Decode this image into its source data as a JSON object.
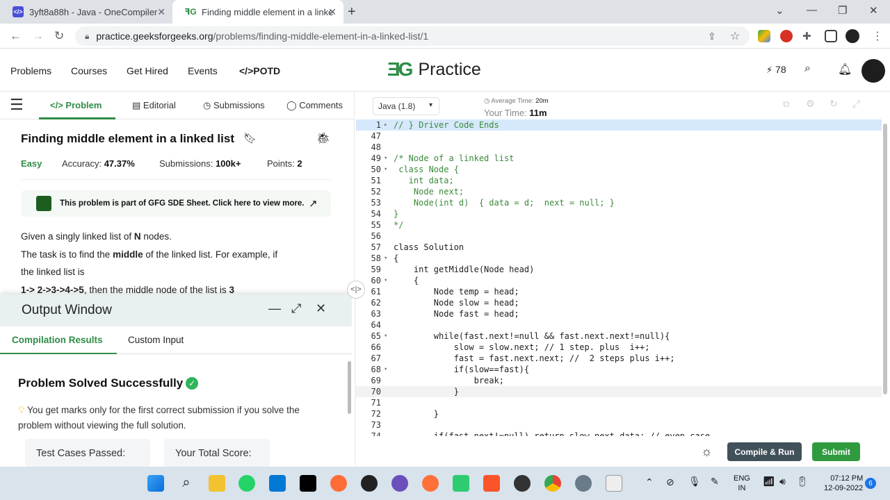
{
  "browser": {
    "tabs": [
      {
        "label": "3yft8a88h - Java - OneCompiler",
        "favicon": "onecompiler-icon",
        "active": false
      },
      {
        "label": "Finding middle element in a linke",
        "favicon": "gfg-icon",
        "active": true
      }
    ],
    "new_tab": "+",
    "url_host": "practice.geeksforgeeks.org",
    "url_path": "/problems/finding-middle-element-in-a-linked-list/1"
  },
  "site": {
    "nav": [
      "Problems",
      "Courses",
      "Get Hired",
      "Events",
      "</>POTD"
    ],
    "logo_text": "Practice",
    "streak": "78"
  },
  "problem": {
    "tabs": [
      "</> Problem",
      "Editorial",
      "Submissions",
      "Comments"
    ],
    "title": "Finding middle element in a linked list",
    "difficulty": "Easy",
    "accuracy_label": "Accuracy:",
    "accuracy": "47.37%",
    "submissions_label": "Submissions:",
    "submissions": "100k+",
    "points_label": "Points:",
    "points": "2",
    "sde_banner": "This problem is part of GFG SDE Sheet. Click here to view more.",
    "line1_a": "Given a singly linked list of ",
    "line1_b": "N",
    "line1_c": " nodes.",
    "line2_a": "The task is to find the ",
    "line2_b": "middle",
    "line2_c": " of the linked list. For example, if",
    "line3": "the linked list is",
    "line4_a": "1-> 2->3->4->5",
    "line4_b": ", then the middle node of the list is ",
    "line4_c": "3"
  },
  "output": {
    "title": "Output Window",
    "tabs": [
      "Compilation Results",
      "Custom Input"
    ],
    "status": "Problem Solved Successfully",
    "note": "You get marks only for the first correct submission if you solve the problem without viewing the full solution.",
    "test_cases_label": "Test Cases Passed:",
    "total_score_label": "Your Total Score:"
  },
  "editor": {
    "language": "Java (1.8)",
    "avg_time_label": "Average Time:",
    "avg_time": "20m",
    "your_time_label": "Your Time:",
    "your_time": "11m",
    "compile_label": "Compile & Run",
    "submit_label": "Submit",
    "lines": [
      {
        "n": "1",
        "fold": "▸",
        "text": "// } Driver Code Ends",
        "cls": "cm"
      },
      {
        "n": "47",
        "fold": "",
        "text": "",
        "cls": ""
      },
      {
        "n": "48",
        "fold": "",
        "text": "",
        "cls": ""
      },
      {
        "n": "49",
        "fold": "▾",
        "text": "/* Node of a linked list",
        "cls": "cm"
      },
      {
        "n": "50",
        "fold": "▾",
        "text": " class Node {",
        "cls": "cm"
      },
      {
        "n": "51",
        "fold": "",
        "text": "   int data;",
        "cls": "cm"
      },
      {
        "n": "52",
        "fold": "",
        "text": "    Node next;",
        "cls": "cm"
      },
      {
        "n": "53",
        "fold": "",
        "text": "    Node(int d)  { data = d;  next = null; }",
        "cls": "cm"
      },
      {
        "n": "54",
        "fold": "",
        "text": "}",
        "cls": "cm"
      },
      {
        "n": "55",
        "fold": "",
        "text": "*/",
        "cls": "cm"
      },
      {
        "n": "56",
        "fold": "",
        "text": "",
        "cls": ""
      },
      {
        "n": "57",
        "fold": "",
        "text": "class Solution",
        "cls": ""
      },
      {
        "n": "58",
        "fold": "▾",
        "text": "{",
        "cls": ""
      },
      {
        "n": "59",
        "fold": "",
        "text": "    int getMiddle(Node head)",
        "cls": ""
      },
      {
        "n": "60",
        "fold": "▾",
        "text": "    {",
        "cls": ""
      },
      {
        "n": "61",
        "fold": "",
        "text": "        Node temp = head;",
        "cls": ""
      },
      {
        "n": "62",
        "fold": "",
        "text": "        Node slow = head;",
        "cls": ""
      },
      {
        "n": "63",
        "fold": "",
        "text": "        Node fast = head;",
        "cls": ""
      },
      {
        "n": "64",
        "fold": "",
        "text": "",
        "cls": ""
      },
      {
        "n": "65",
        "fold": "▾",
        "text": "        while(fast.next!=null && fast.next.next!=null){",
        "cls": ""
      },
      {
        "n": "66",
        "fold": "",
        "text": "            slow = slow.next; // 1 step. plus  i++;",
        "cls": ""
      },
      {
        "n": "67",
        "fold": "",
        "text": "            fast = fast.next.next; //  2 steps plus i++;",
        "cls": ""
      },
      {
        "n": "68",
        "fold": "▾",
        "text": "            if(slow==fast){",
        "cls": ""
      },
      {
        "n": "69",
        "fold": "",
        "text": "                break;",
        "cls": ""
      },
      {
        "n": "70",
        "fold": "",
        "text": "            }",
        "cls": ""
      },
      {
        "n": "71",
        "fold": "",
        "text": "",
        "cls": ""
      },
      {
        "n": "72",
        "fold": "",
        "text": "        }",
        "cls": ""
      },
      {
        "n": "73",
        "fold": "",
        "text": "",
        "cls": ""
      },
      {
        "n": "74",
        "fold": "",
        "text": "        if(fast.next!=null) return slow.next.data; // even case",
        "cls": ""
      }
    ]
  },
  "taskbar": {
    "lang_top": "ENG",
    "lang_bottom": "IN",
    "time": "07:12 PM",
    "date": "12-09-2022",
    "notifications": "6"
  }
}
